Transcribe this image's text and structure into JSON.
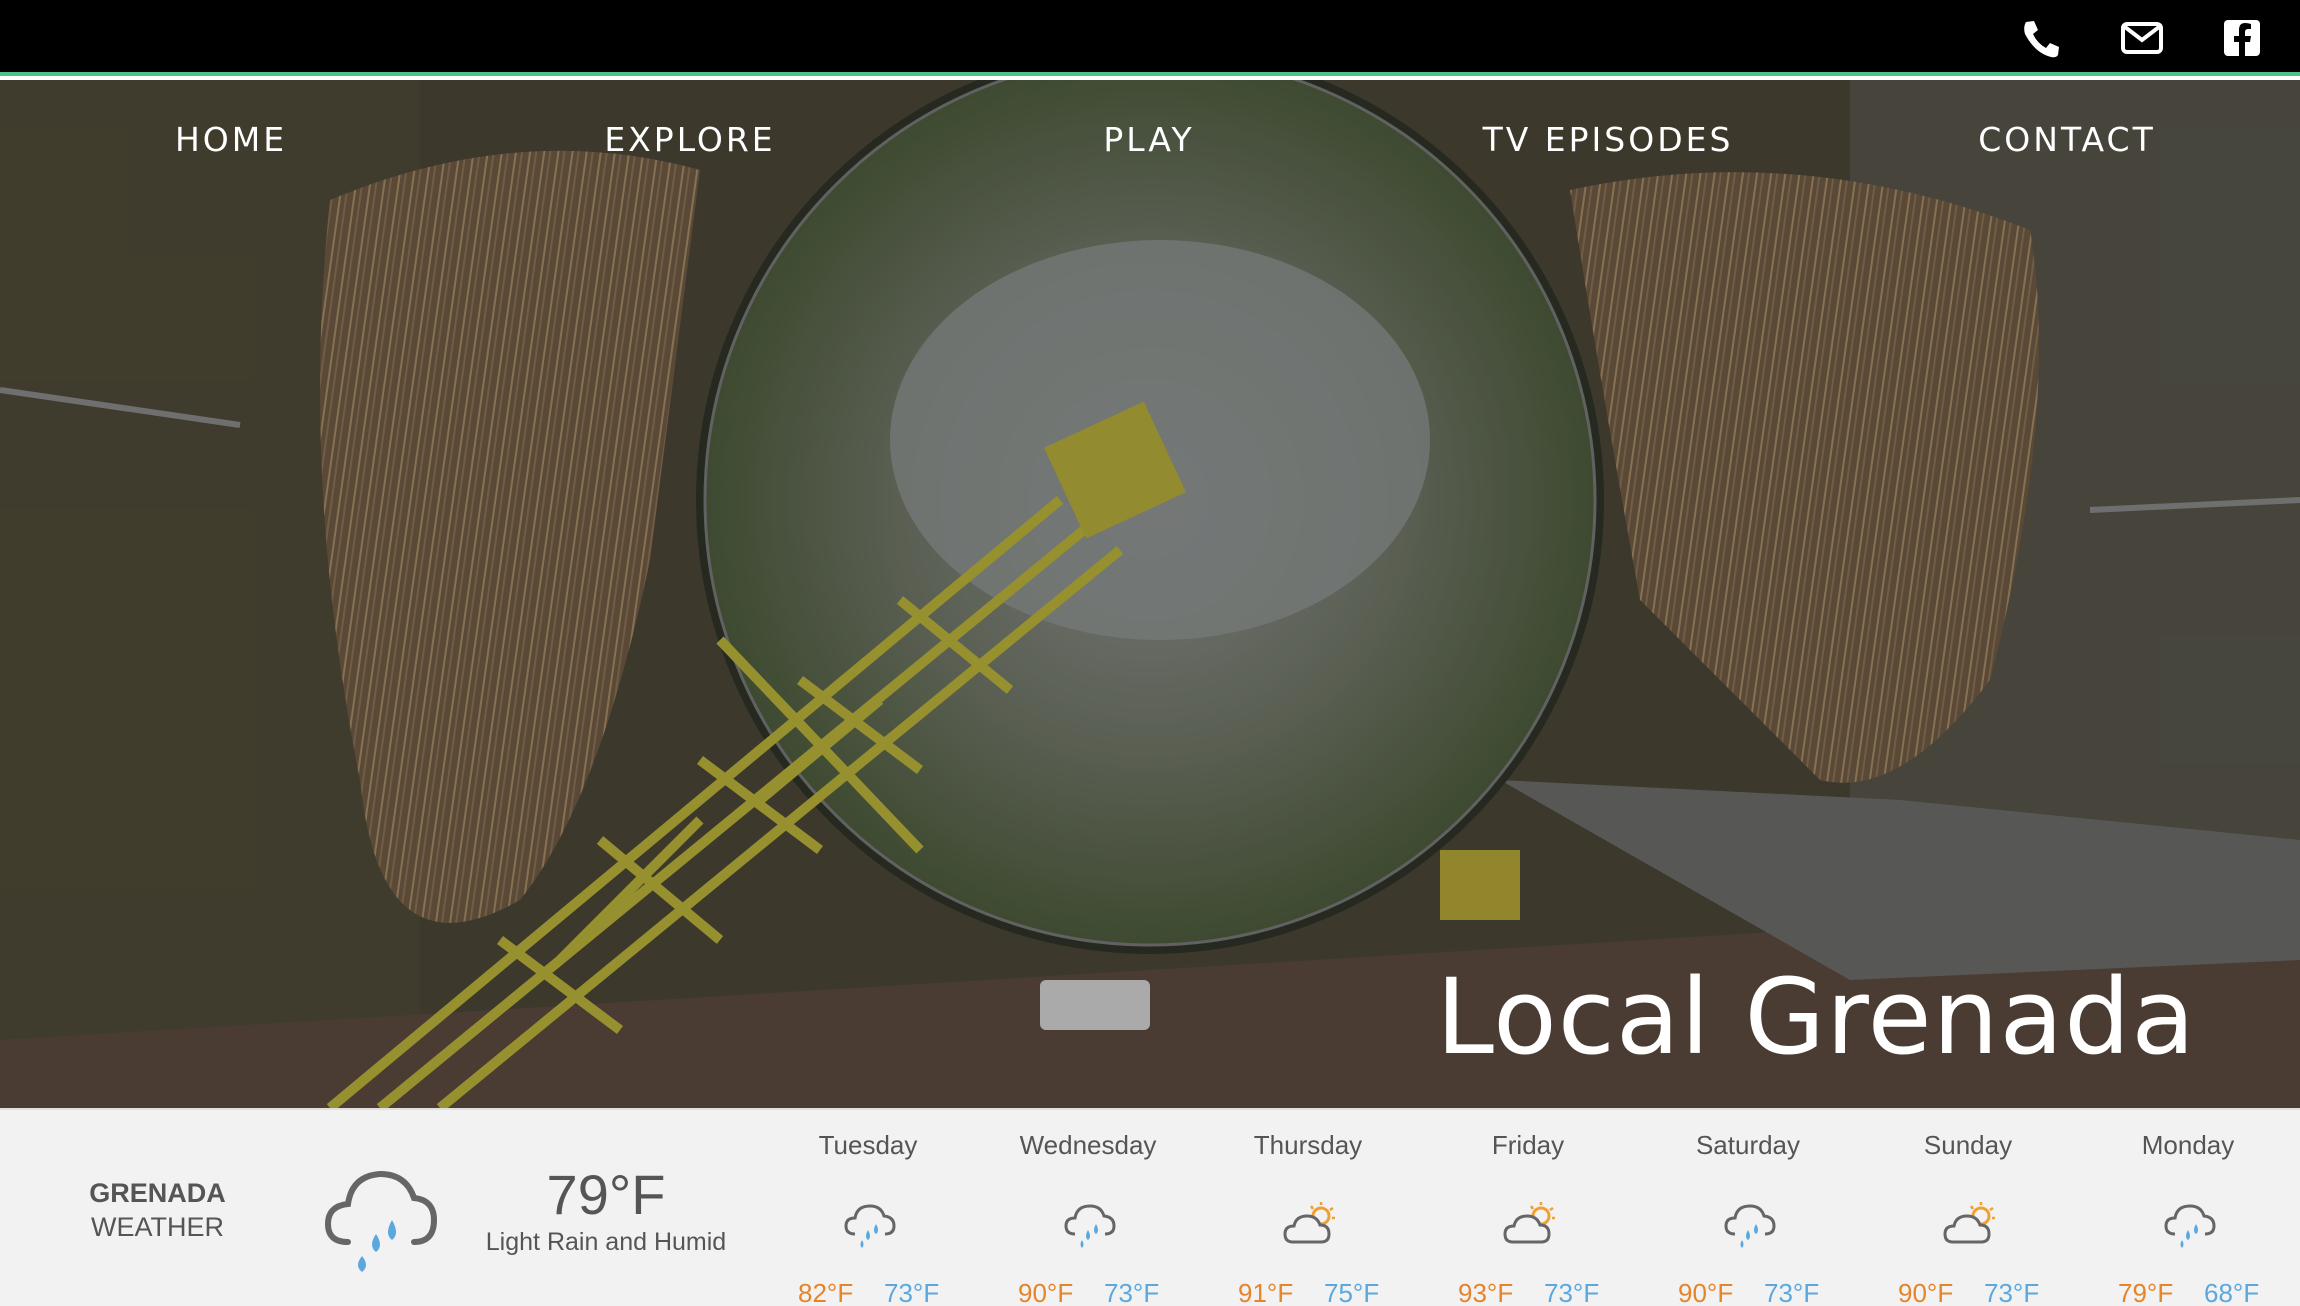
{
  "topbar": {
    "icons": [
      "phone-icon",
      "envelope-icon",
      "facebook-icon"
    ],
    "accent_color": "#4fc08d"
  },
  "nav": {
    "items": [
      {
        "label": "HOME"
      },
      {
        "label": "EXPLORE"
      },
      {
        "label": "PLAY"
      },
      {
        "label": "TV EPISODES"
      },
      {
        "label": "CONTACT"
      }
    ]
  },
  "hero": {
    "title": "Local Grenada"
  },
  "weather": {
    "city": "GRENADA",
    "label": "WEATHER",
    "current": {
      "icon": "rain-cloud-icon",
      "temp": "79°F",
      "description": "Light Rain and Humid"
    },
    "forecast": [
      {
        "day": "Tuesday",
        "icon": "rain-cloud-icon",
        "high": "82°F",
        "low": "73°F"
      },
      {
        "day": "Wednesday",
        "icon": "rain-cloud-icon",
        "high": "90°F",
        "low": "73°F"
      },
      {
        "day": "Thursday",
        "icon": "partly-sunny-icon",
        "high": "91°F",
        "low": "75°F"
      },
      {
        "day": "Friday",
        "icon": "partly-sunny-icon",
        "high": "93°F",
        "low": "73°F"
      },
      {
        "day": "Saturday",
        "icon": "rain-cloud-icon",
        "high": "90°F",
        "low": "73°F"
      },
      {
        "day": "Sunday",
        "icon": "partly-sunny-icon",
        "high": "90°F",
        "low": "73°F"
      },
      {
        "day": "Monday",
        "icon": "rain-cloud-icon",
        "high": "79°F",
        "low": "68°F"
      }
    ],
    "colors": {
      "high": "#e6842a",
      "low": "#5aa8de",
      "rain": "#5aa8de",
      "sun": "#f0a030"
    }
  }
}
